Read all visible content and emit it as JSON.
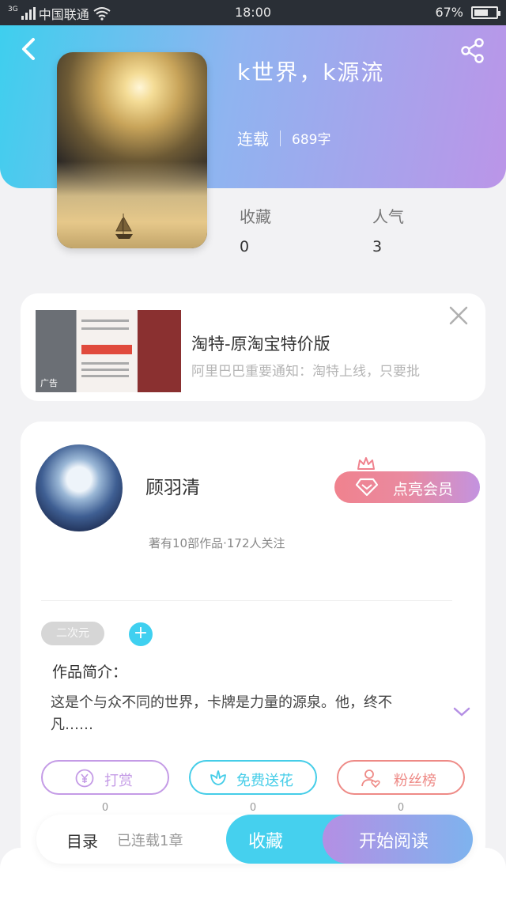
{
  "status_bar": {
    "network": "3G",
    "carrier": "中国联通",
    "time": "18:00",
    "battery": "67%",
    "battery_level": 0.67
  },
  "book": {
    "title": "k世界，k源流",
    "status": "连载",
    "word_count": "689字",
    "stats": [
      {
        "label": "收藏",
        "value": "0"
      },
      {
        "label": "人气",
        "value": "3"
      }
    ]
  },
  "ad": {
    "title": "淘特-原淘宝特价版",
    "description": "阿里巴巴重要通知：淘特上线，只要批",
    "tag": "广告"
  },
  "author": {
    "name": "顾羽清",
    "info": "著有10部作品·172人关注",
    "vip_label": "点亮会员"
  },
  "tags": {
    "chip": "二次元",
    "add": "+"
  },
  "intro": {
    "title": "作品简介：",
    "text": "这是个与众不同的世界，卡牌是力量的源泉。他，终不凡……"
  },
  "actions": [
    {
      "label": "打赏",
      "count": "0",
      "color": "#c49be6"
    },
    {
      "label": "免费送花",
      "count": "0",
      "color": "#45cde8"
    },
    {
      "label": "粉丝榜",
      "count": "0",
      "color": "#ee8a86"
    }
  ],
  "bottom_bar": {
    "toc_label": "目录",
    "toc_status": "已连载1章",
    "favorite_label": "收藏",
    "read_label": "开始阅读"
  },
  "colors": {
    "accent_cyan": "#3fd0f0",
    "accent_purple": "#bb95e8"
  }
}
